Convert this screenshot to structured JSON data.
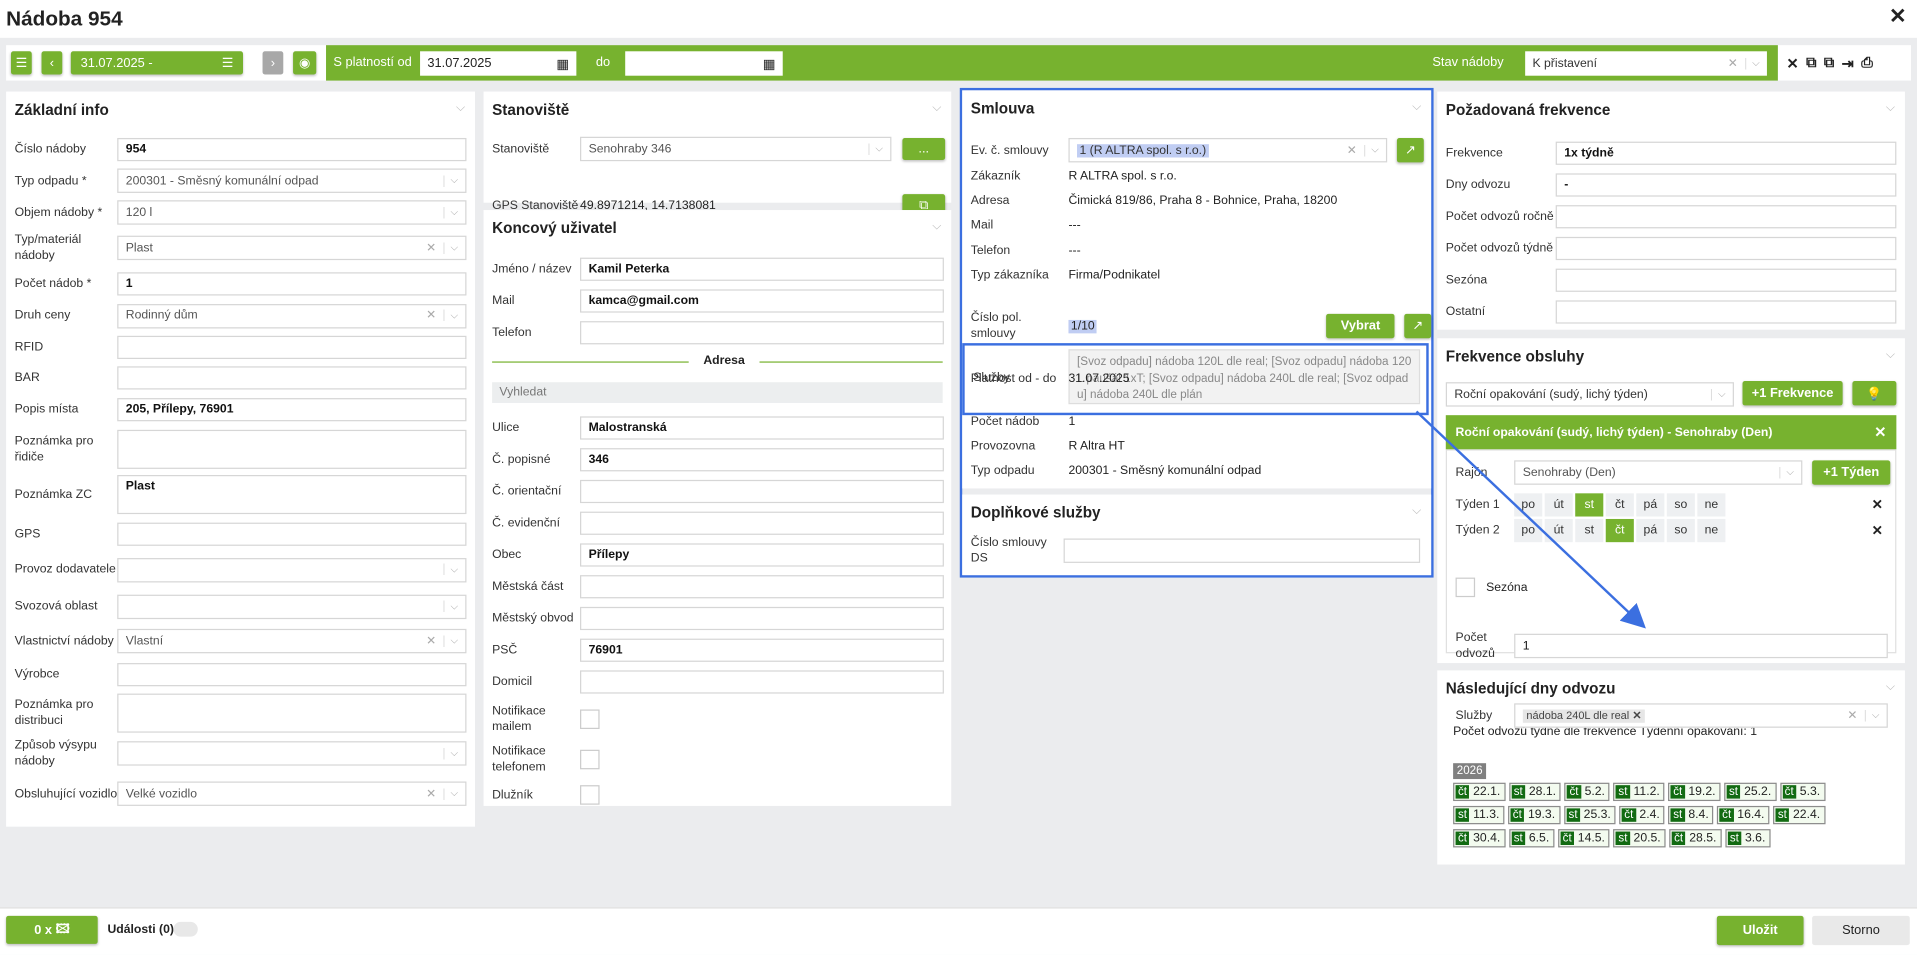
{
  "window": {
    "title": "Nádoba 954",
    "close_icon": "close-icon"
  },
  "toolbar": {
    "period": "31.07.2025 -",
    "valid_from_label": "S platností od",
    "valid_from": "31.07.2025",
    "to_label": "do",
    "to": "",
    "status_label": "Stav nádoby",
    "status": "K přistavení",
    "icons": [
      "menu-icon",
      "chevron-left-icon",
      "list-icon",
      "chevron-right-icon",
      "eye-icon",
      "calendar-icon",
      "close-icon",
      "copy-left-icon",
      "copy-right-icon",
      "export-icon",
      "print-icon"
    ]
  },
  "basic": {
    "title": "Základní info",
    "rows": [
      {
        "label": "Číslo nádoby",
        "value": "954",
        "kind": "input"
      },
      {
        "label": "Typ odpadu *",
        "value": "200301 - Směsný komunální odpad",
        "kind": "select"
      },
      {
        "label": "Objem nádoby *",
        "value": "120 l",
        "kind": "select"
      },
      {
        "label": "Typ/materiál nádoby",
        "value": "Plast",
        "kind": "select-clear"
      },
      {
        "label": "Počet nádob *",
        "value": "1",
        "kind": "input"
      },
      {
        "label": "Druh ceny",
        "value": "Rodinný dům",
        "kind": "select-clear"
      },
      {
        "label": "RFID",
        "value": "",
        "kind": "input"
      },
      {
        "label": "BAR",
        "value": "",
        "kind": "input"
      },
      {
        "label": "Popis místa",
        "value": "205, Přílepy, 76901",
        "kind": "input"
      },
      {
        "label": "Poznámka pro řidiče",
        "value": "",
        "kind": "textarea"
      },
      {
        "label": "Poznámka ZC",
        "value": "Plast",
        "kind": "textarea"
      },
      {
        "label": "GPS",
        "value": "",
        "kind": "input"
      },
      {
        "label": "Provoz dodavatele",
        "value": "",
        "kind": "select"
      },
      {
        "label": "Svozová oblast",
        "value": "",
        "kind": "select"
      },
      {
        "label": "Vlastnictví nádoby",
        "value": "Vlastní",
        "kind": "select-clear"
      },
      {
        "label": "Výrobce",
        "value": "",
        "kind": "input"
      },
      {
        "label": "Poznámka pro distribuci",
        "value": "",
        "kind": "textarea"
      },
      {
        "label": "Způsob výsypu nádoby",
        "value": "",
        "kind": "select"
      },
      {
        "label": "Obsluhující vozidlo",
        "value": "Velké vozidlo",
        "kind": "select-clear"
      }
    ]
  },
  "site": {
    "title": "Stanoviště",
    "site_label": "Stanoviště",
    "site_value": "Senohraby 346",
    "more_button": "...",
    "gps_label": "GPS Stanoviště",
    "gps_value": "49.8971214, 14.7138081"
  },
  "end_user": {
    "title": "Koncový uživatel",
    "rows_top": [
      {
        "label": "Jméno / název",
        "value": "Kamil Peterka",
        "kind": "input"
      },
      {
        "label": "Mail",
        "value": "kamca@gmail.com",
        "kind": "input"
      },
      {
        "label": "Telefon",
        "value": "",
        "kind": "input"
      }
    ],
    "address_divider": "Adresa",
    "search_placeholder": "Vyhledat",
    "rows_address": [
      {
        "label": "Ulice",
        "value": "Malostranská",
        "kind": "input"
      },
      {
        "label": "Č. popisné",
        "value": "346",
        "kind": "input"
      },
      {
        "label": "Č. orientační",
        "value": "",
        "kind": "input"
      },
      {
        "label": "Č. evidenční",
        "value": "",
        "kind": "input"
      },
      {
        "label": "Obec",
        "value": "Přílepy",
        "kind": "input"
      },
      {
        "label": "Městská část",
        "value": "",
        "kind": "input"
      },
      {
        "label": "Městský obvod",
        "value": "",
        "kind": "input"
      },
      {
        "label": "PSČ",
        "value": "76901",
        "kind": "input"
      },
      {
        "label": "Domicil",
        "value": "",
        "kind": "input"
      },
      {
        "label": "Notifikace mailem",
        "value": "",
        "kind": "checkbox"
      },
      {
        "label": "Notifikace telefonem",
        "value": "",
        "kind": "checkbox"
      },
      {
        "label": "Dlužník",
        "value": "",
        "kind": "checkbox"
      }
    ]
  },
  "contract": {
    "title": "Smlouva",
    "ev_label": "Ev. č. smlouvy",
    "ev_value": "1 (R ALTRA spol. s r.o.)",
    "info": [
      {
        "label": "Zákazník",
        "value": "R ALTRA spol. s r.o."
      },
      {
        "label": "Adresa",
        "value": "Čimická 819/86, Praha 8 - Bohnice, Praha, 18200"
      },
      {
        "label": "Mail",
        "value": "---"
      },
      {
        "label": "Telefon",
        "value": "---"
      },
      {
        "label": "Typ zákazníka",
        "value": "Firma/Podnikatel"
      }
    ],
    "pol_label": "Číslo pol. smlouvy",
    "pol_value": "1/10",
    "select_button": "Vybrat",
    "validity_label": "Platnost od - do",
    "validity_value": "31.07.2025",
    "services_label": "Služby",
    "services_value": "[Svoz odpadu] nádoba 120L dle real; [Svoz odpadu] nádoba 120 L paušál 1xT; [Svoz odpadu]  nádoba 240L dle real; [Svoz odpadu]  nádoba 240L dle plán",
    "info2": [
      {
        "label": "Počet nádob",
        "value": "1"
      },
      {
        "label": "Provozovna",
        "value": "R Altra HT"
      },
      {
        "label": "Typ odpadu",
        "value": "200301 - Směsný komunální odpad"
      }
    ]
  },
  "extra_services": {
    "title": "Doplňkové služby",
    "ds_label": "Číslo smlouvy DS",
    "ds_value": ""
  },
  "required_freq": {
    "title": "Požadovaná frekvence",
    "rows": [
      {
        "label": "Frekvence",
        "value": "1x týdně",
        "kind": "input"
      },
      {
        "label": "Dny odvozu",
        "value": "-",
        "kind": "input"
      },
      {
        "label": "Počet odvozů ročně",
        "value": "",
        "kind": "input"
      },
      {
        "label": "Počet odvozů týdně",
        "value": "",
        "kind": "input"
      },
      {
        "label": "Sezóna",
        "value": "",
        "kind": "input"
      },
      {
        "label": "Ostatní",
        "value": "",
        "kind": "input"
      }
    ]
  },
  "service_freq": {
    "title": "Frekvence obsluhy",
    "freq_select": "Roční opakování (sudý, lichý týden)",
    "add_freq_button": "+1 Frekvence",
    "card_title": "Roční opakování (sudý, lichý týden) - Senohraby (Den)",
    "district_label": "Rajón",
    "district_value": "Senohraby (Den)",
    "add_week_button": "+1 Týden",
    "weeks": [
      {
        "label": "Týden 1",
        "days": [
          "po",
          "út",
          "st",
          "čt",
          "pá",
          "so",
          "ne"
        ],
        "selected": "st"
      },
      {
        "label": "Týden 2",
        "days": [
          "po",
          "út",
          "st",
          "čt",
          "pá",
          "so",
          "ne"
        ],
        "selected": "čt"
      }
    ],
    "season_label": "Sezóna",
    "count_label": "Počet odvozů",
    "count_value": "1",
    "services_label": "Služby",
    "services_tag": "nádoba 240L dle real"
  },
  "next_days": {
    "title": "Následující dny odvozu",
    "summary": "Počet odvozů týdně dle frekvence Týdenní opakování: 1",
    "year": "2026",
    "dates": [
      {
        "day": "čt",
        "date": "22.1."
      },
      {
        "day": "st",
        "date": "28.1."
      },
      {
        "day": "čt",
        "date": "5.2."
      },
      {
        "day": "st",
        "date": "11.2."
      },
      {
        "day": "čt",
        "date": "19.2."
      },
      {
        "day": "st",
        "date": "25.2."
      },
      {
        "day": "čt",
        "date": "5.3."
      },
      {
        "day": "st",
        "date": "11.3."
      },
      {
        "day": "čt",
        "date": "19.3."
      },
      {
        "day": "st",
        "date": "25.3."
      },
      {
        "day": "čt",
        "date": "2.4."
      },
      {
        "day": "st",
        "date": "8.4."
      },
      {
        "day": "čt",
        "date": "16.4."
      },
      {
        "day": "st",
        "date": "22.4."
      },
      {
        "day": "čt",
        "date": "30.4."
      },
      {
        "day": "st",
        "date": "6.5."
      },
      {
        "day": "čt",
        "date": "14.5."
      },
      {
        "day": "st",
        "date": "20.5."
      },
      {
        "day": "čt",
        "date": "28.5."
      },
      {
        "day": "st",
        "date": "3.6."
      }
    ]
  },
  "bottom": {
    "photos_button": "0 x",
    "events_label": "Události (0)",
    "save_button": "Uložit",
    "cancel_button": "Storno"
  },
  "colors": {
    "green": "#77b22f",
    "dark_green": "#126b12",
    "annotation_blue": "#3b6fe0"
  }
}
